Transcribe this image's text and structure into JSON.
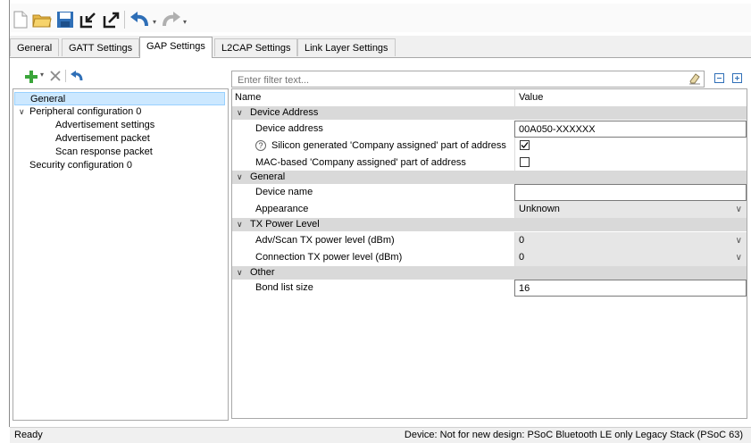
{
  "toolbar": {
    "icons": [
      "new-file-icon",
      "open-folder-icon",
      "save-icon",
      "import-icon",
      "export-icon",
      "undo-icon",
      "redo-icon"
    ]
  },
  "tabs": [
    {
      "label": "General",
      "active": false
    },
    {
      "label": "GATT Settings",
      "active": false
    },
    {
      "label": "GAP Settings",
      "active": true
    },
    {
      "label": "L2CAP Settings",
      "active": false
    },
    {
      "label": "Link Layer Settings",
      "active": false
    }
  ],
  "tree": {
    "items": [
      {
        "label": "General",
        "selected": true
      },
      {
        "label": "Peripheral configuration 0",
        "expanded": true
      },
      {
        "label": "Advertisement settings"
      },
      {
        "label": "Advertisement packet"
      },
      {
        "label": "Scan response packet"
      },
      {
        "label": "Security configuration 0"
      }
    ]
  },
  "filter": {
    "placeholder": "Enter filter text..."
  },
  "grid": {
    "col_name": "Name",
    "col_value": "Value",
    "groups": [
      {
        "name": "Device Address"
      },
      {
        "name": "General"
      },
      {
        "name": "TX Power Level"
      },
      {
        "name": "Other"
      }
    ],
    "props": {
      "device_address": {
        "name": "Device address",
        "value": "00A050-XXXXXX"
      },
      "silicon_generated": {
        "name": "Silicon generated 'Company assigned' part of address",
        "checked": true
      },
      "mac_based": {
        "name": "MAC-based 'Company assigned' part of address",
        "checked": false
      },
      "device_name": {
        "name": "Device name",
        "value": ""
      },
      "appearance": {
        "name": "Appearance",
        "value": "Unknown"
      },
      "adv_scan_tx": {
        "name": "Adv/Scan TX power level (dBm)",
        "value": "0"
      },
      "conn_tx": {
        "name": "Connection TX power level (dBm)",
        "value": "0"
      },
      "bond_list": {
        "name": "Bond list size",
        "value": "16"
      }
    },
    "help_glyph": "?"
  },
  "status": {
    "left": "Ready",
    "right": "Device: Not for new design: PSoC Bluetooth LE only Legacy Stack (PSoC 63)"
  },
  "colors": {
    "group_bg": "#d9d9d9",
    "selection": "#cce8ff",
    "accent_green": "#3aa53a",
    "accent_blue": "#2f6fb7"
  }
}
